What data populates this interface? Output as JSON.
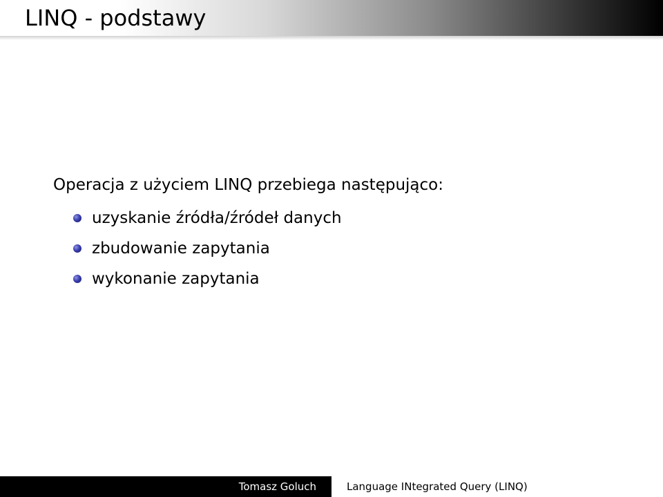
{
  "slide": {
    "title": "LINQ - podstawy",
    "intro": "Operacja z użyciem LINQ przebiega następująco:",
    "bullets": [
      "uzyskanie źródła/źródeł danych",
      "zbudowanie zapytania",
      "wykonanie zapytania"
    ]
  },
  "footer": {
    "author": "Tomasz Goluch",
    "topic": "Language INtegrated Query (LINQ)"
  },
  "colors": {
    "bullet": "#3a3fb0",
    "footer_bg": "#000000",
    "footer_text": "#ffffff"
  },
  "icons": {
    "bullet": "ball-bullet-icon"
  }
}
